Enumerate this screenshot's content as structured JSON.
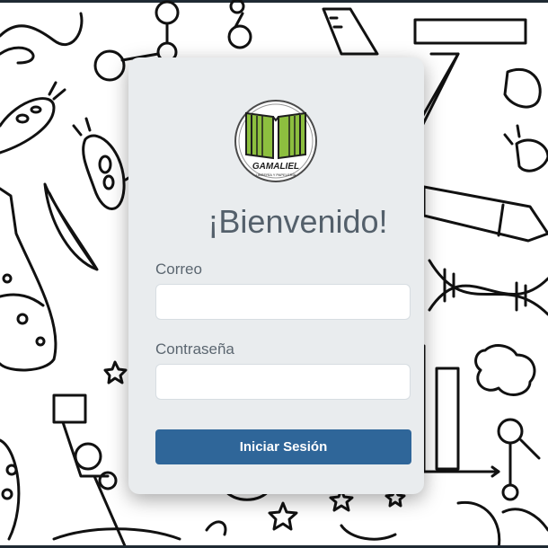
{
  "login": {
    "welcome": "¡Bienvenido!",
    "email_label": "Correo",
    "email_value": "",
    "password_label": "Contraseña",
    "password_value": "",
    "submit_label": "Iniciar Sesión"
  },
  "logo": {
    "name": "GAMALIEL",
    "tagline": "LIBRERÍA Y PAPELERÍA"
  },
  "colors": {
    "card_bg": "#e9ecee",
    "button_bg": "#2f6699",
    "logo_green": "#8dbf3f",
    "text": "#54606b"
  }
}
